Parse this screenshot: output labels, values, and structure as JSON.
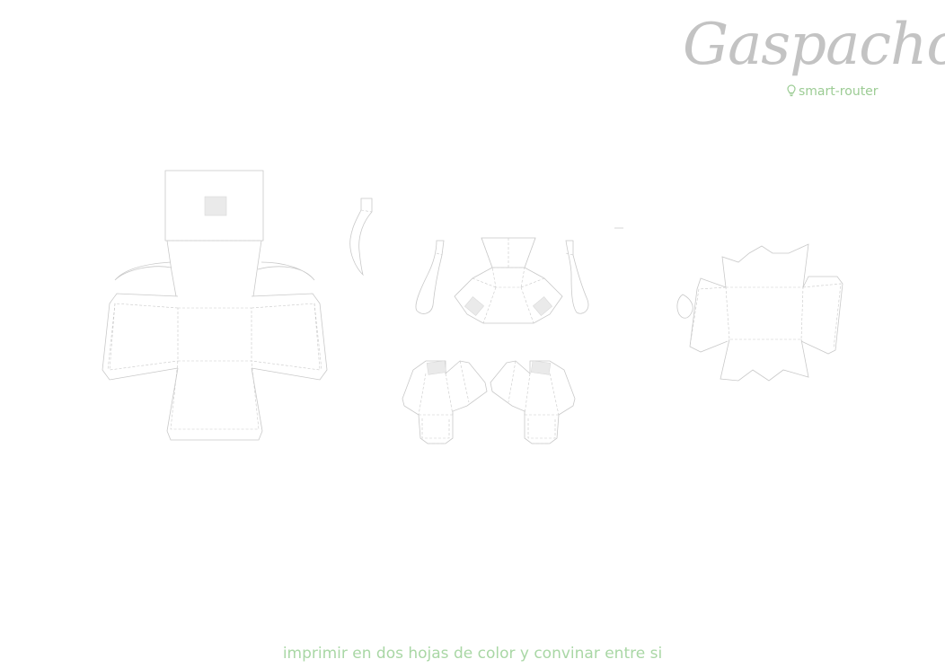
{
  "brand": {
    "title": "Gaspacho",
    "subtitle": "smart-router"
  },
  "icons": {
    "subtitle_icon": "lightbulb-icon"
  },
  "colors": {
    "title": "#c3c3c3",
    "subtitle": "#9ccc94",
    "footer": "#a9d7a5",
    "cut_lines": "#c9c9c9",
    "fill_patches": "#eaeaea"
  },
  "footer": {
    "instruction": "imprimir en dos hojas de color y convinar entre si"
  }
}
